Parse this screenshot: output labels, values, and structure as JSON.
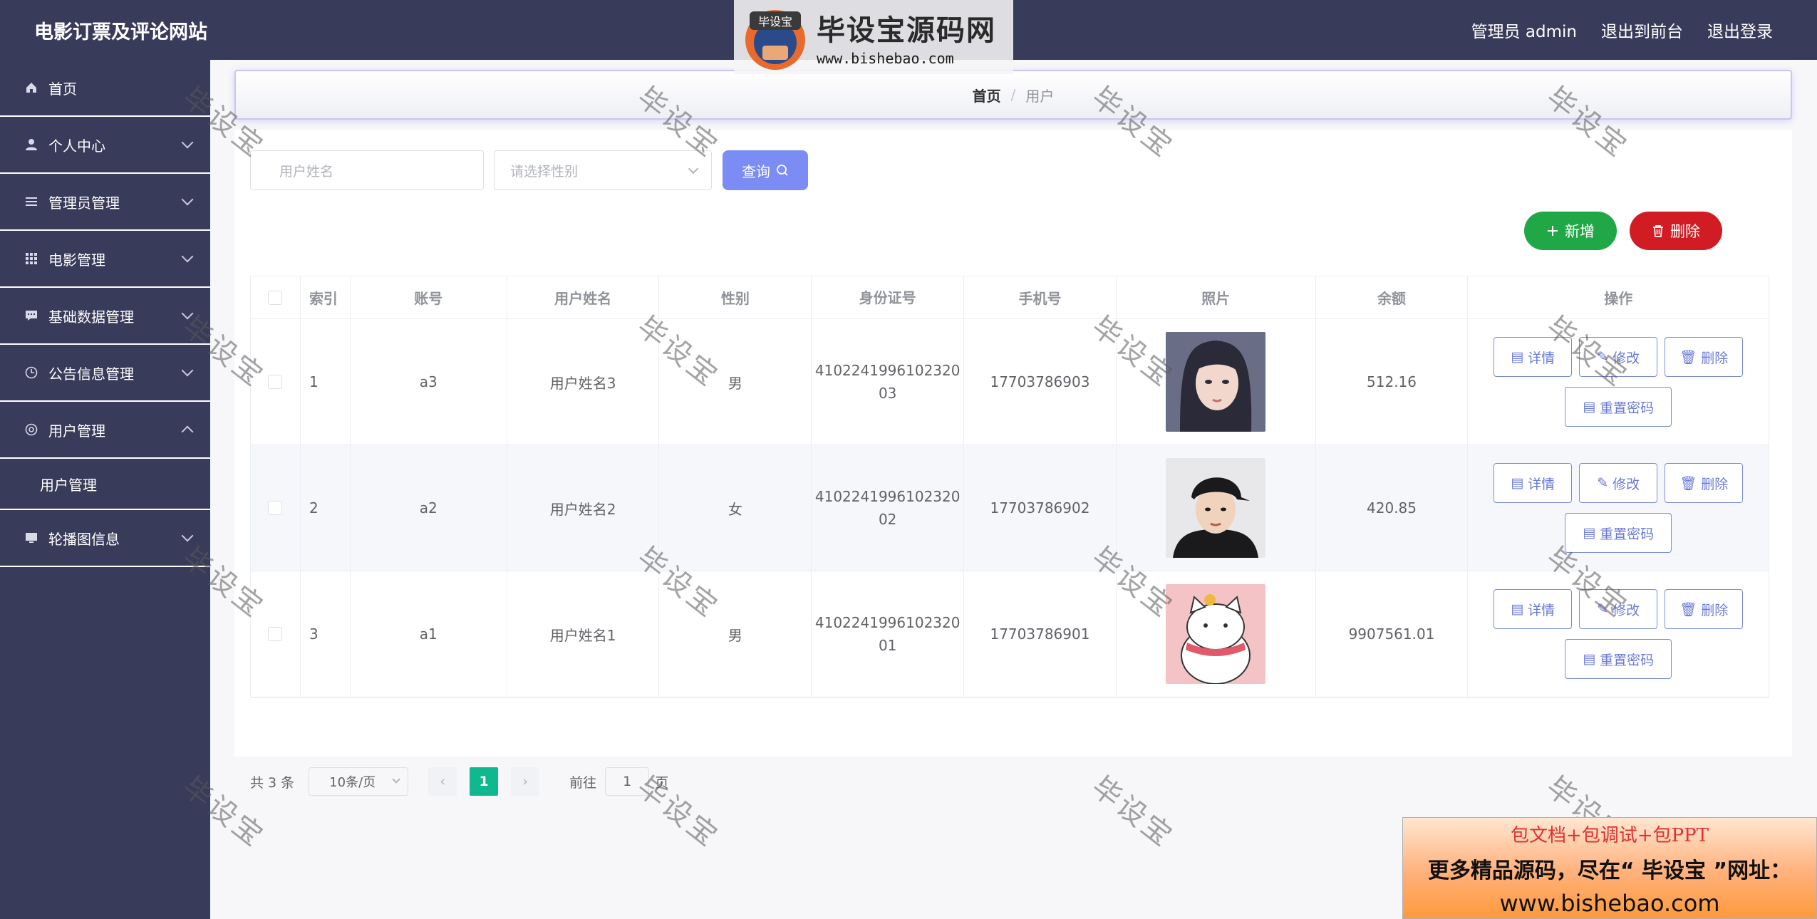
{
  "app": {
    "title": "电影订票及评论网站"
  },
  "header": {
    "admin_label": "管理员 admin",
    "back_front": "退出到前台",
    "logout": "退出登录"
  },
  "sidebar": {
    "items": [
      {
        "label": "首页",
        "icon": "home-icon"
      },
      {
        "label": "个人中心",
        "icon": "user-icon"
      },
      {
        "label": "管理员管理",
        "icon": "list-icon"
      },
      {
        "label": "电影管理",
        "icon": "grid-icon"
      },
      {
        "label": "基础数据管理",
        "icon": "chat-icon"
      },
      {
        "label": "公告信息管理",
        "icon": "clock-icon"
      },
      {
        "label": "用户管理",
        "icon": "settings-icon",
        "expanded": true,
        "children": [
          "用户管理"
        ]
      },
      {
        "label": "轮播图信息",
        "icon": "monitor-icon"
      }
    ]
  },
  "breadcrumb": {
    "home": "首页",
    "separator": "/",
    "current": "用户"
  },
  "search": {
    "name_placeholder": "用户姓名",
    "sex_placeholder": "请选择性别",
    "query_label": "查询"
  },
  "actions": {
    "add_label": "新增",
    "delete_label": "删除"
  },
  "table": {
    "columns": [
      "索引",
      "账号",
      "用户姓名",
      "性别",
      "身份证号",
      "手机号",
      "照片",
      "余额",
      "操作"
    ],
    "rows": [
      {
        "index": "1",
        "account": "a3",
        "name": "用户姓名3",
        "sex": "男",
        "id_line1": "4102241996102320",
        "id_line2": "03",
        "phone": "17703786903",
        "balance": "512.16"
      },
      {
        "index": "2",
        "account": "a2",
        "name": "用户姓名2",
        "sex": "女",
        "id_line1": "4102241996102320",
        "id_line2": "02",
        "phone": "17703786902",
        "balance": "420.85"
      },
      {
        "index": "3",
        "account": "a1",
        "name": "用户姓名1",
        "sex": "男",
        "id_line1": "4102241996102320",
        "id_line2": "01",
        "phone": "17703786901",
        "balance": "9907561.01"
      }
    ],
    "row_ops": {
      "detail": "详情",
      "edit": "修改",
      "delete": "删除",
      "reset": "重置密码"
    }
  },
  "pagination": {
    "total": "共 3 条",
    "page_size": "10条/页",
    "current_page": "1",
    "goto_label": "前往",
    "goto_value": "1",
    "page_suffix": "页"
  },
  "watermark": {
    "text": "毕设宝"
  },
  "logo": {
    "badge": "毕设宝",
    "title": "毕设宝源码网",
    "url": "www.bishebao.com"
  },
  "ad": {
    "line1": "包文档+包调试+包PPT",
    "line2": "更多精品源码，尽在“ 毕设宝 ”网址：",
    "line3": "www.bishebao.com"
  },
  "colors": {
    "sidebar_bg": "#383b5a",
    "query_btn": "#7b8cf5",
    "add_btn": "#21a846",
    "delete_btn": "#d01c22",
    "active_page": "#10b890"
  }
}
